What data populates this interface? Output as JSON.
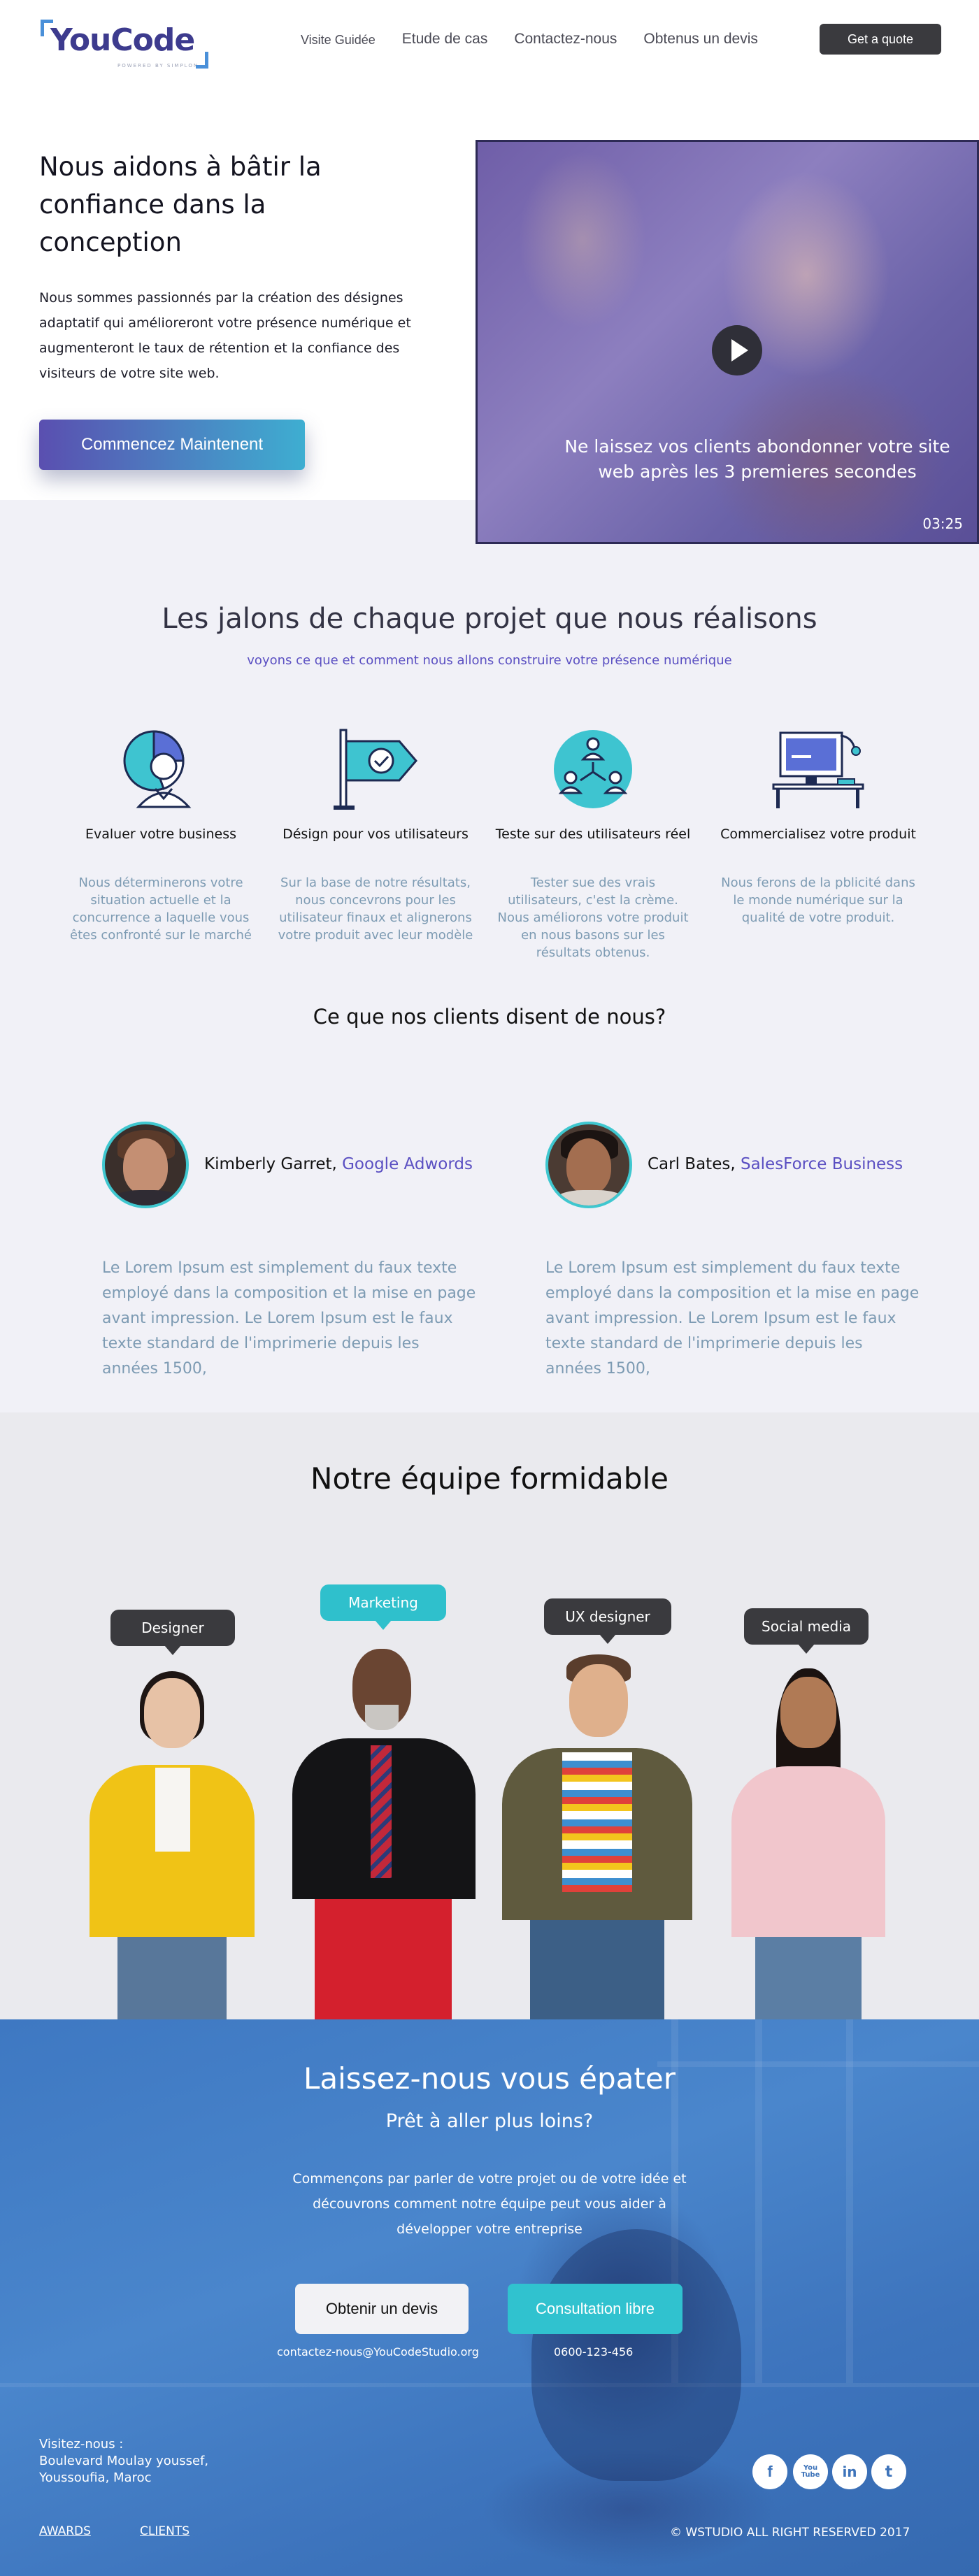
{
  "header": {
    "logo_text": "YouCode",
    "logo_tagline": "POWERED BY SIMPLON",
    "nav": [
      "Visite Guidée",
      "Etude de cas",
      "Contactez-nous",
      "Obtenus un devis"
    ],
    "quote_button": "Get a quote"
  },
  "hero": {
    "title": "Nous aidons à bâtir la confiance dans la conception",
    "text": "Nous sommes passionnés par la création des désignes adaptatif qui amélioreront votre présence numérique et augmenteront le taux de rétention et la confiance des visiteurs de votre site web.",
    "cta": "Commencez Maintenent",
    "video_caption": "Ne laissez vos clients abondonner votre site web après les 3 premieres secondes",
    "video_time": "03:25"
  },
  "milestones": {
    "title": "Les jalons de chaque projet que nous réalisons",
    "subtitle": "voyons ce que et comment nous allons construire votre présence numérique",
    "steps": [
      {
        "icon": "user-chart-icon",
        "name": "Evaluer votre business",
        "desc": "Nous déterminerons votre situation actuelle et la concurrence a laquelle vous êtes confronté sur le marché"
      },
      {
        "icon": "flag-check-icon",
        "name": "Désign pour vos utilisateurs",
        "desc": "Sur la base de notre résultats, nous concevrons pour les utilisateur finaux et alignerons votre produit avec leur modèle"
      },
      {
        "icon": "user-network-icon",
        "name": "Teste sur des utilisateurs réel",
        "desc": "Tester sue des vrais utilisateurs, c'est la crème. Nous améliorons votre produit en nous basons sur les résultats obtenus."
      },
      {
        "icon": "desk-computer-icon",
        "name": "Commercialisez votre produit",
        "desc": "Nous ferons de la pblicité dans le monde numérique sur la qualité de votre produit."
      }
    ]
  },
  "testimonials": {
    "title": "Ce que nos clients disent de nous?",
    "items": [
      {
        "name": "Kimberly Garret,",
        "company": "Google Adwords",
        "quote": "Le Lorem Ipsum est simplement du faux texte employé dans la composition et la mise en page avant impression. Le Lorem Ipsum est le faux texte standard de l'imprimerie depuis les années 1500,"
      },
      {
        "name": "Carl Bates,",
        "company": "SalesForce Business",
        "quote": "Le Lorem Ipsum est simplement du faux texte employé dans la composition et la mise en page avant impression. Le Lorem Ipsum est le faux texte standard de l'imprimerie depuis les années 1500,"
      }
    ]
  },
  "team": {
    "title": "Notre équipe formidable",
    "roles": [
      "Designer",
      "Marketing",
      "UX designer",
      "Social media"
    ]
  },
  "cta": {
    "title": "Laissez-nous vous épater",
    "subtitle": "Prêt à aller plus loins?",
    "text": "Commençons par parler de votre projet ou de votre idée et découvrons comment notre équipe peut vous aider à développer votre entreprise",
    "devis_button": "Obtenir un devis",
    "consult_button": "Consultation libre",
    "email": "contactez-nous@YouCodeStudio.org",
    "phone": "0600-123-456"
  },
  "footer": {
    "address_label": "Visitez-nous :",
    "address_line1": "Boulevard Moulay youssef,",
    "address_line2": "Youssoufia, Maroc",
    "social": [
      {
        "icon": "facebook-icon",
        "glyph": "f"
      },
      {
        "icon": "youtube-icon",
        "glyph": "You Tube"
      },
      {
        "icon": "linkedin-icon",
        "glyph": "in"
      },
      {
        "icon": "twitter-icon",
        "glyph": "t"
      }
    ],
    "links": [
      "AWARDS",
      "CLIENTS"
    ],
    "copyright": "© WSTUDIO ALL RIGHT RESERVED 2017"
  },
  "colors": {
    "brand": "#3d3b8e",
    "accent_purple": "#5a4fc2",
    "accent_teal": "#2fc0cc",
    "muted_text": "#7d9bb3",
    "dark_button": "#3a3a3e",
    "cta_blue": "#3e78c2"
  }
}
